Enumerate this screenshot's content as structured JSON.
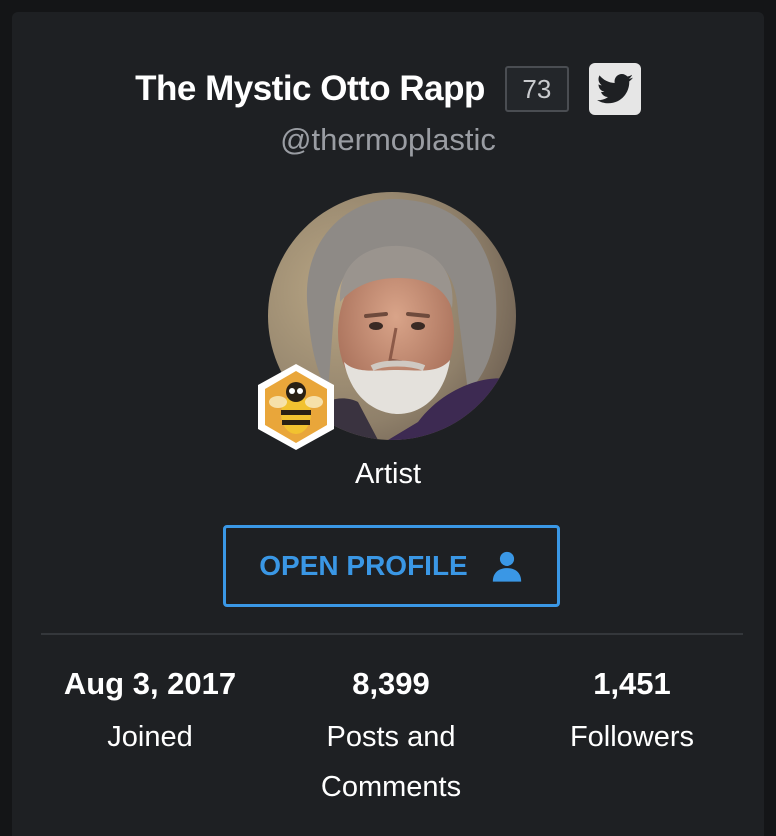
{
  "profile": {
    "name": "The Mystic Otto Rapp",
    "level": "73",
    "handle": "@thermoplastic",
    "role": "Artist",
    "avatar_icon": "portrait-photo",
    "badge_icon": "bee-hexagon-badge",
    "social_icon": "twitter-icon"
  },
  "actions": {
    "open_profile_label": "OPEN PROFILE",
    "open_profile_icon": "user-icon"
  },
  "stats": [
    {
      "value": "Aug 3, 2017",
      "label": "Joined"
    },
    {
      "value": "8,399",
      "label": "Posts and Comments"
    },
    {
      "value": "1,451",
      "label": "Followers"
    }
  ],
  "colors": {
    "background": "#1e2023",
    "accent": "#3a97e5",
    "muted_text": "#9a9da3"
  }
}
